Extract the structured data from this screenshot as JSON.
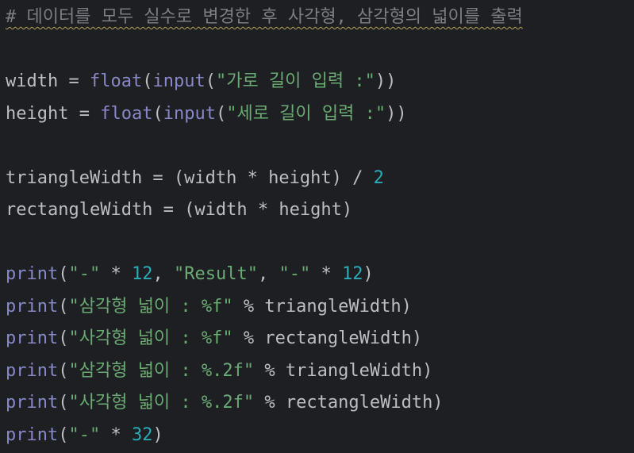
{
  "editor": {
    "lines": {
      "l1": {
        "comment": "# 데이터를 모두 실수로 변경한 후 사각형, 삼각형의 넓이를 출력"
      },
      "l3": {
        "var": "width",
        "eq": " = ",
        "fn1": "float",
        "p1": "(",
        "fn2": "input",
        "p2": "(",
        "str": "\"가로 길이 입력 :\"",
        "p3": "))"
      },
      "l4": {
        "var": "height",
        "eq": " = ",
        "fn1": "float",
        "p1": "(",
        "fn2": "input",
        "p2": "(",
        "str": "\"세로 길이 입력 :\"",
        "p3": "))"
      },
      "l6": {
        "lhs": "triangleWidth = (width * height) / ",
        "num": "2"
      },
      "l7": {
        "text": "rectangleWidth = (width * height)"
      },
      "l9": {
        "fn": "print",
        "p1": "(",
        "s1": "\"-\"",
        "o1": " * ",
        "n1": "12",
        "c1": ", ",
        "s2": "\"Result\"",
        "c2": ", ",
        "s3": "\"-\"",
        "o2": " * ",
        "n2": "12",
        "p2": ")"
      },
      "l10": {
        "fn": "print",
        "p1": "(",
        "str": "\"삼각형 넓이 : %f\"",
        "rest": " % triangleWidth)"
      },
      "l11": {
        "fn": "print",
        "p1": "(",
        "str": "\"사각형 넓이 : %f\"",
        "rest": " % rectangleWidth)"
      },
      "l12": {
        "fn": "print",
        "p1": "(",
        "str": "\"삼각형 넓이 : %.2f\"",
        "rest": " % triangleWidth)"
      },
      "l13": {
        "fn": "print",
        "p1": "(",
        "str": "\"사각형 넓이 : %.2f\"",
        "rest": " % rectangleWidth)"
      },
      "l14": {
        "fn": "print",
        "p1": "(",
        "str": "\"-\"",
        "o1": " * ",
        "num": "32",
        "p2": ")"
      }
    }
  }
}
